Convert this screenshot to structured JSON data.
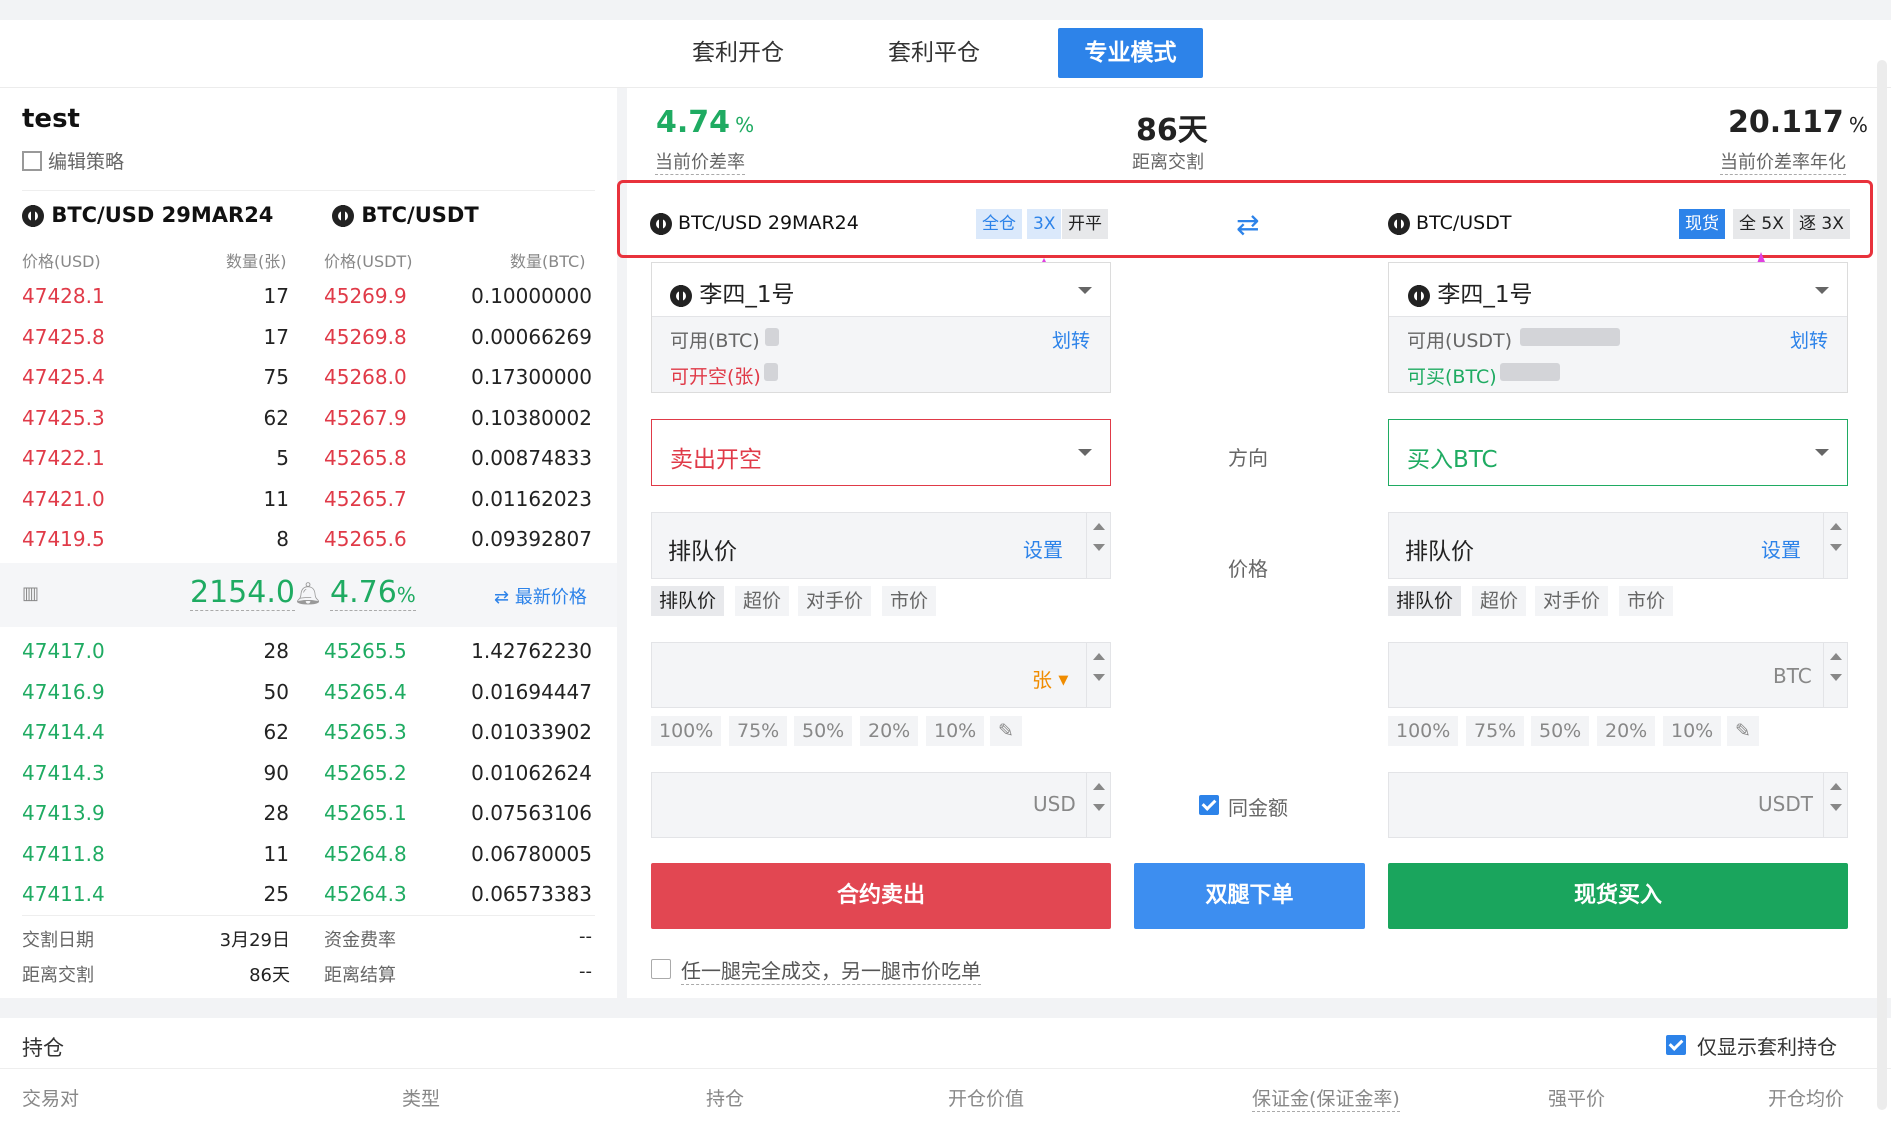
{
  "tabs": [
    {
      "label": "套利开仓"
    },
    {
      "label": "套利平仓"
    },
    {
      "label": "专业模式",
      "active": true
    }
  ],
  "strategy": {
    "name": "test",
    "edit_label": "编辑策略"
  },
  "stats": [
    {
      "value": "4.74",
      "unit": "%",
      "label": "当前价差率",
      "color": "#1fab62"
    },
    {
      "value": "86天",
      "unit": "",
      "label": "距离交割",
      "color": "#111"
    },
    {
      "value": "20.117",
      "unit": "%",
      "label": "当前价差率年化",
      "color": "#111"
    }
  ],
  "orderbook": {
    "left_pair": "BTC/USD 29MAR24",
    "right_pair": "BTC/USDT",
    "headers": [
      "价格(USD)",
      "数量(张)",
      "价格(USDT)",
      "数量(BTC)"
    ],
    "asks": [
      [
        "47428.1",
        "17",
        "45269.9",
        "0.10000000"
      ],
      [
        "47425.8",
        "17",
        "45269.8",
        "0.00066269"
      ],
      [
        "47425.4",
        "75",
        "45268.0",
        "0.17300000"
      ],
      [
        "47425.3",
        "62",
        "45267.9",
        "0.10380002"
      ],
      [
        "47422.1",
        "5",
        "45265.8",
        "0.00874833"
      ],
      [
        "47421.0",
        "11",
        "45265.7",
        "0.01162023"
      ],
      [
        "47419.5",
        "8",
        "45265.6",
        "0.09392807"
      ]
    ],
    "mid": {
      "spread": "2154.0",
      "rate": "4.76",
      "rate_unit": "%",
      "latest_label": "最新价格"
    },
    "bids": [
      [
        "47417.0",
        "28",
        "45265.5",
        "1.42762230"
      ],
      [
        "47416.9",
        "50",
        "45265.4",
        "0.01694447"
      ],
      [
        "47414.4",
        "62",
        "45265.3",
        "0.01033902"
      ],
      [
        "47414.3",
        "90",
        "45265.2",
        "0.01062624"
      ],
      [
        "47413.9",
        "28",
        "45265.1",
        "0.07563106"
      ],
      [
        "47411.8",
        "11",
        "45264.8",
        "0.06780005"
      ],
      [
        "47411.4",
        "25",
        "45264.3",
        "0.06573383"
      ]
    ],
    "footer": {
      "delivery_date_label": "交割日期",
      "delivery_date": "3月29日",
      "funding_label": "资金费率",
      "funding": "--",
      "to_delivery_label": "距离交割",
      "to_delivery": "86天",
      "to_settle_label": "距离结算",
      "to_settle": "--"
    }
  },
  "legs": {
    "left": {
      "pair": "BTC/USD 29MAR24",
      "tags": [
        "全仓",
        "3X",
        "开平"
      ],
      "account": "李四_1号",
      "avail_label": "可用(BTC)",
      "transfer_label": "划转",
      "open_label": "可开空(张)",
      "direction": "卖出开空",
      "price_type": "排队价",
      "set_label": "设置",
      "price_chips": [
        "排队价",
        "超价",
        "对手价",
        "市价"
      ],
      "qty_unit": "张",
      "pcts": [
        "100%",
        "75%",
        "50%",
        "20%",
        "10%"
      ],
      "amount_unit": "USD",
      "action": "合约卖出",
      "accent": "#e24752"
    },
    "right": {
      "pair": "BTC/USDT",
      "tags": [
        "现货",
        "全 5X",
        "逐 3X"
      ],
      "account": "李四_1号",
      "avail_label": "可用(USDT)",
      "transfer_label": "划转",
      "open_label": "可买(BTC)",
      "direction": "买入BTC",
      "price_type": "排队价",
      "set_label": "设置",
      "price_chips": [
        "排队价",
        "超价",
        "对手价",
        "市价"
      ],
      "qty_unit": "BTC",
      "pcts": [
        "100%",
        "75%",
        "50%",
        "20%",
        "10%"
      ],
      "amount_unit": "USDT",
      "action": "现货买入",
      "accent": "#1aa55d"
    }
  },
  "middle": {
    "direction_label": "方向",
    "price_label": "价格",
    "same_amount_label": "同金额",
    "dual_button": "双腿下单"
  },
  "option_label": "任一腿完全成交，另一腿市价吃单",
  "positions": {
    "title": "持仓",
    "only_arb_label": "仅显示套利持仓",
    "columns": [
      "交易对",
      "类型",
      "持仓",
      "开仓价值",
      "保证金(保证金率)",
      "强平价",
      "开仓均价"
    ]
  },
  "colors": {
    "primary": "#2d83e9",
    "red": "#e03a48",
    "green": "#1fab62",
    "highlight_box": "#e8323c",
    "arrow": "#e040e0"
  }
}
